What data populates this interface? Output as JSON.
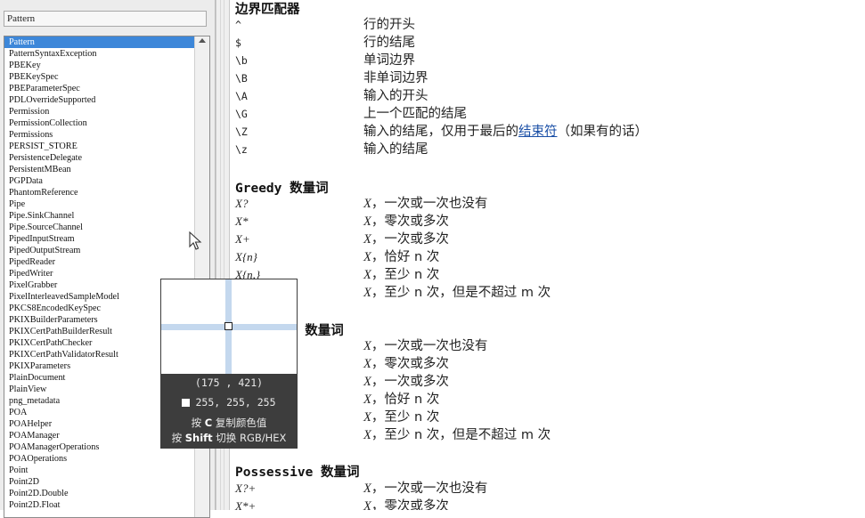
{
  "left_panel": {
    "search_value": "Pattern",
    "selected_index": 0,
    "classes": [
      "Pattern",
      "PatternSyntaxException",
      "PBEKey",
      "PBEKeySpec",
      "PBEParameterSpec",
      "PDLOverrideSupported",
      "Permission",
      "PermissionCollection",
      "Permissions",
      "PERSIST_STORE",
      "PersistenceDelegate",
      "PersistentMBean",
      "PGPData",
      "PhantomReference",
      "Pipe",
      "Pipe.SinkChannel",
      "Pipe.SourceChannel",
      "PipedInputStream",
      "PipedOutputStream",
      "PipedReader",
      "PipedWriter",
      "PixelGrabber",
      "PixelInterleavedSampleModel",
      "PKCS8EncodedKeySpec",
      "PKIXBuilderParameters",
      "PKIXCertPathBuilderResult",
      "PKIXCertPathChecker",
      "PKIXCertPathValidatorResult",
      "PKIXParameters",
      "PlainDocument",
      "PlainView",
      "png_metadata",
      "POA",
      "POAHelper",
      "POAManager",
      "POAManagerOperations",
      "POAOperations",
      "Point",
      "Point2D",
      "Point2D.Double",
      "Point2D.Float"
    ]
  },
  "content": {
    "boundary": {
      "title": "边界匹配器",
      "rows": [
        {
          "code": "^",
          "desc": "行的开头"
        },
        {
          "code": "$",
          "desc": "行的结尾"
        },
        {
          "code": "\\b",
          "desc": "单词边界"
        },
        {
          "code": "\\B",
          "desc": "非单词边界"
        },
        {
          "code": "\\A",
          "desc": "输入的开头"
        },
        {
          "code": "\\G",
          "desc": "上一个匹配的结尾"
        },
        {
          "code": "\\Z",
          "desc_pre": "输入的结尾，仅用于最后的",
          "desc_link": "结束符",
          "desc_post": "（如果有的话）"
        },
        {
          "code": "\\z",
          "desc": "输入的结尾"
        }
      ]
    },
    "greedy": {
      "title": "Greedy 数量词",
      "rows": [
        {
          "code": "X?",
          "desc": "一次或一次也没有"
        },
        {
          "code": "X*",
          "desc": "零次或多次"
        },
        {
          "code": "X+",
          "desc": "一次或多次"
        },
        {
          "code": "X{n}",
          "desc": "恰好 n 次"
        },
        {
          "code": "X{n,}",
          "desc": "至少 n 次"
        },
        {
          "code": "",
          "desc": "至少 n 次，但是不超过 m 次"
        }
      ]
    },
    "reluctant": {
      "title": "nt 数量词",
      "rows": [
        {
          "code": "",
          "desc": "一次或一次也没有"
        },
        {
          "code": "",
          "desc": "零次或多次"
        },
        {
          "code": "",
          "desc": "一次或多次"
        },
        {
          "code": "",
          "desc": "恰好 n 次"
        },
        {
          "code": "",
          "desc": "至少 n 次"
        },
        {
          "code": "",
          "desc": "至少 n 次，但是不超过 m 次"
        }
      ]
    },
    "possessive": {
      "title": "Possessive 数量词",
      "rows": [
        {
          "code": "X?+",
          "desc": "一次或一次也没有"
        },
        {
          "code": "X*+",
          "desc": "零次或多次"
        }
      ]
    }
  },
  "color_picker": {
    "coords": "(175 , 421)",
    "rgb": "255, 255, 255",
    "hint_copy_pre": "按",
    "hint_copy_key": "C",
    "hint_copy_post": "复制颜色值",
    "hint_switch_pre": "按",
    "hint_switch_key": "Shift",
    "hint_switch_post": "切换 RGB/HEX",
    "swatch_color": "#ffffff"
  },
  "colors": {
    "selection": "#3d87d9",
    "link": "#1a4fa6",
    "picker_bg": "#3d3d3d"
  }
}
